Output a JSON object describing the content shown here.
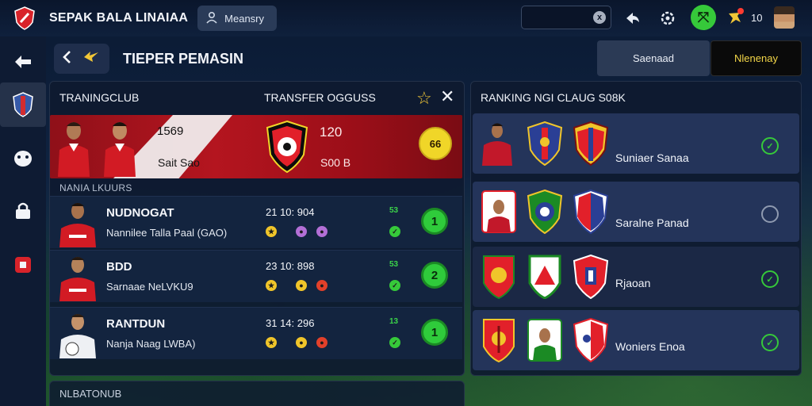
{
  "topbar": {
    "title": "SEPAK BALA LINAIAA",
    "menu_label": "Meansry",
    "search_clear": "x",
    "count": "10"
  },
  "header": {
    "page_title": "TIEPER PEMASIN",
    "tabs": [
      {
        "label": "Saenaad"
      },
      {
        "label": "Nlenenay"
      }
    ]
  },
  "left_panel": {
    "heading_left": "TRANINGCLUB",
    "heading_right": "TRANSFER OGGUSS",
    "banner": {
      "value_left": "1569",
      "sub_left": "Sait Sao",
      "value_right": "120",
      "sub_right": "S00 B",
      "coin_label": "66"
    },
    "section_label": "NANIA LKUURS",
    "rows": [
      {
        "name": "NUDNOGAT",
        "sub": "Nannilee Talla Paal (GAO)",
        "stats": "21  10: 904",
        "tag": "53",
        "button": "1"
      },
      {
        "name": "BDD",
        "sub": "Sarnaae NeLVKU9",
        "stats": "23  10: 898",
        "tag": "53",
        "button": "2"
      },
      {
        "name": "RANTDUN",
        "sub": "Nanja Naag LWBA)",
        "stats": "31  14: 296",
        "tag": "13",
        "button": "1"
      }
    ],
    "bottom_label": "NLBATONUB"
  },
  "right_panel": {
    "heading": "RANKING NGI CLAUG S08K",
    "rows": [
      {
        "name": "Suniaer Sanaa",
        "checked": true
      },
      {
        "name": "Saralne Panad",
        "checked": false
      },
      {
        "name": "Rjaoan",
        "checked": true
      },
      {
        "name": "Woniers Enoa",
        "checked": true
      }
    ]
  },
  "colors": {
    "accent_green": "#36c93a",
    "banner_red": "#b4151f",
    "gold": "#f0d628"
  }
}
